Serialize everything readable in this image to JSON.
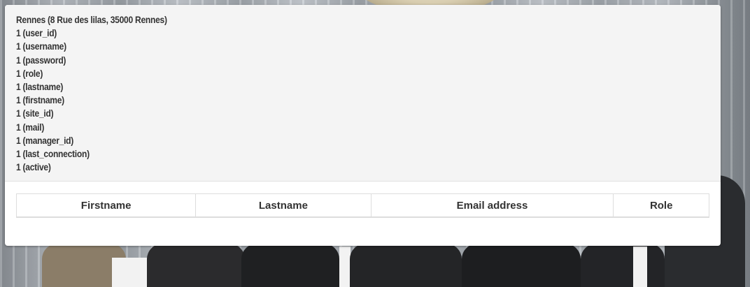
{
  "site": {
    "header": "Rennes (8 Rue des lilas, 35000 Rennes)",
    "fields": [
      "1 (user_id)",
      "1 (username)",
      "1 (password)",
      "1 (role)",
      "1 (lastname)",
      "1 (firstname)",
      "1 (site_id)",
      "1 (mail)",
      "1 (manager_id)",
      "1 (last_connection)",
      "1 (active)"
    ]
  },
  "table": {
    "columns": [
      "Firstname",
      "Lastname",
      "Email address",
      "Role"
    ]
  },
  "colors": {
    "header_bg": "#f4f4f4",
    "panel_bg": "#ffffff",
    "text": "#333333",
    "border": "#dddddd"
  }
}
